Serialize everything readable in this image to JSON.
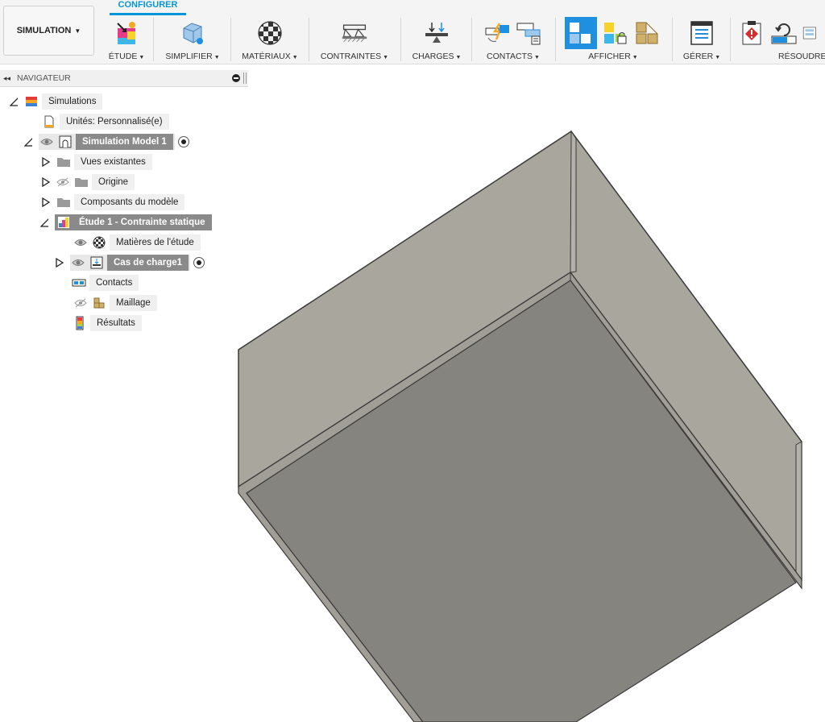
{
  "toolbar": {
    "workspace_label": "SIMULATION",
    "active_tab": "CONFIGURER",
    "groups": {
      "etude": "ÉTUDE",
      "simplifier": "SIMPLIFIER",
      "materiaux": "MATÉRIAUX",
      "contraintes": "CONTRAINTES",
      "charges": "CHARGES",
      "contacts": "CONTACTS",
      "afficher": "AFFICHER",
      "gerer": "GÉRER",
      "resoudre": "RÉSOUDRE"
    },
    "accent_color": "#0696d7"
  },
  "navigator": {
    "title": "NAVIGATEUR",
    "items": [
      {
        "label": "Simulations"
      },
      {
        "label": "Unités: Personnalisé(e)"
      },
      {
        "label": "Simulation Model 1"
      },
      {
        "label": "Vues existantes"
      },
      {
        "label": "Origine"
      },
      {
        "label": "Composants du modèle"
      },
      {
        "label": "Étude 1 - Contrainte statique"
      },
      {
        "label": "Matières de l'étude"
      },
      {
        "label": "Cas de charge1"
      },
      {
        "label": "Contacts"
      },
      {
        "label": "Maillage"
      },
      {
        "label": "Résultats"
      }
    ]
  },
  "viewport": {
    "model_top_color": "#a8a69d",
    "model_face_color": "#85847e",
    "background": "#ffffff"
  }
}
